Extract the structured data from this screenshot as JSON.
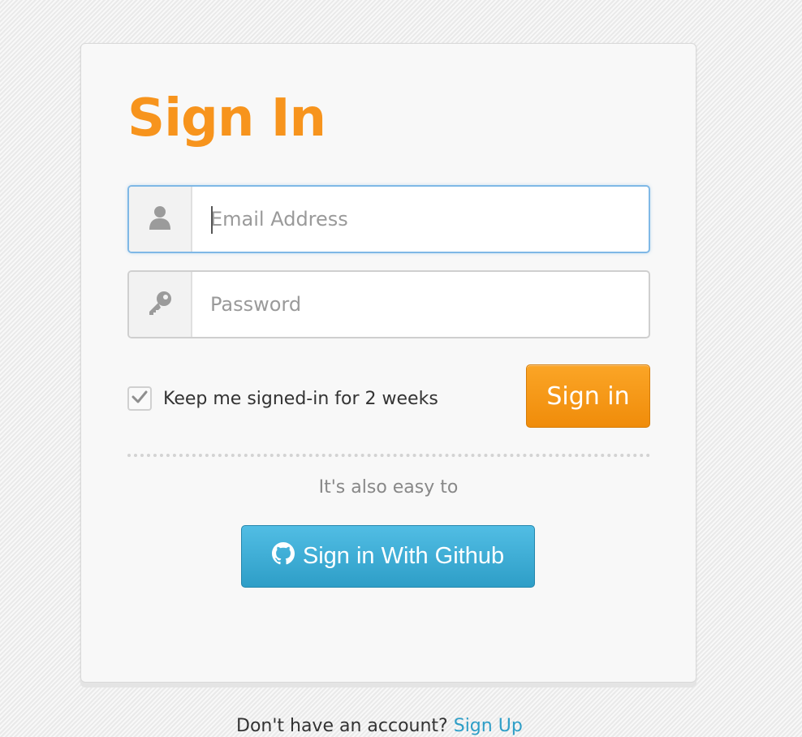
{
  "form": {
    "title": "Sign In",
    "email_placeholder": "Email Address",
    "password_placeholder": "Password",
    "remember_label": "Keep me signed-in for 2 weeks",
    "remember_checked": true,
    "signin_label": "Sign in",
    "easy_text": "It's also easy to",
    "github_label": "Sign in With Github"
  },
  "footer": {
    "prompt": "Don't have an account?",
    "signup_link": "Sign Up"
  },
  "colors": {
    "accent": "#f7941d",
    "github": "#3aaed8",
    "focus": "#7fb8e6"
  },
  "icons": {
    "email": "user-icon",
    "password": "key-icon",
    "checkbox": "checkmark-icon",
    "github": "github-icon"
  }
}
